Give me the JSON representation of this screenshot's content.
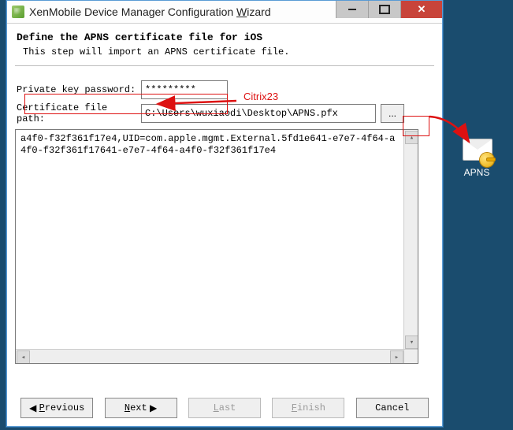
{
  "window": {
    "title_prefix": "XenMobile Device Manager Configuration ",
    "title_mnemonic": "W",
    "title_suffix": "izard"
  },
  "page": {
    "heading": "Define the APNS certificate file for iOS",
    "subheading": "This step will import an APNS certificate file."
  },
  "fields": {
    "password_label": "Private key password:",
    "password_value": "*********",
    "path_label": "Certificate file path:",
    "path_value": "C:\\Users\\wuxiaodi\\Desktop\\APNS.pfx",
    "browse_label": "...",
    "cert_text": "a4f0-f32f361f17e4,UID=com.apple.mgmt.External.5fd1e641-e7e7-4f64-a4f0-f32f361f17641-e7e7-4f64-a4f0-f32f361f17e4"
  },
  "annotation": {
    "password_hint": "Citrix23"
  },
  "buttons": {
    "previous": "Previous",
    "next": "Next",
    "last": "Last",
    "finish": "Finish",
    "cancel": "Cancel"
  },
  "desktop": {
    "apns_label": "APNS"
  }
}
